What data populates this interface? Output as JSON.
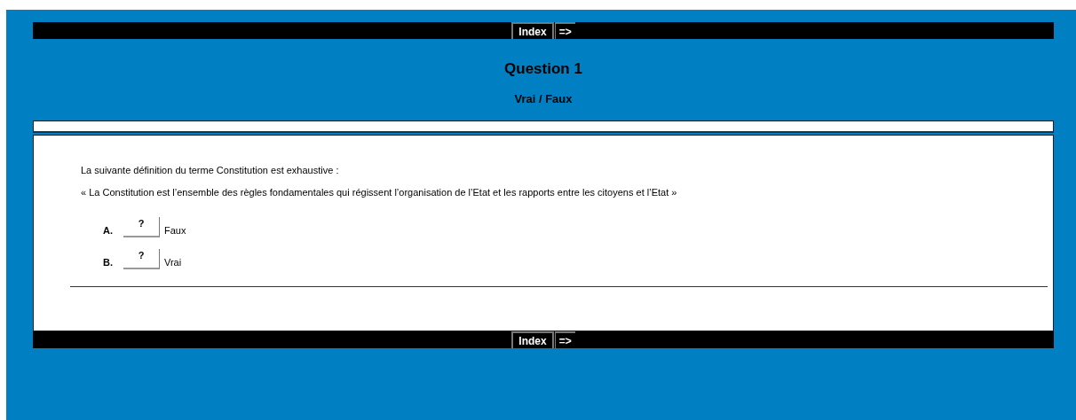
{
  "nav_top": {
    "index": "Index",
    "next": "=>"
  },
  "title": "Question 1",
  "subtitle": "Vrai / Faux",
  "question": {
    "prompt": "La suivante définition du terme Constitution est exhaustive :",
    "quote": "« La Constitution est l’ensemble des règles fondamentales qui régissent l’organisation de l’Etat et les rapports entre les citoyens et l’Etat »"
  },
  "answers": [
    {
      "letter": "A.",
      "value": "?",
      "label": "Faux"
    },
    {
      "letter": "B.",
      "value": "?",
      "label": "Vrai"
    }
  ],
  "nav_bottom": {
    "index": "Index",
    "next": "=>"
  }
}
